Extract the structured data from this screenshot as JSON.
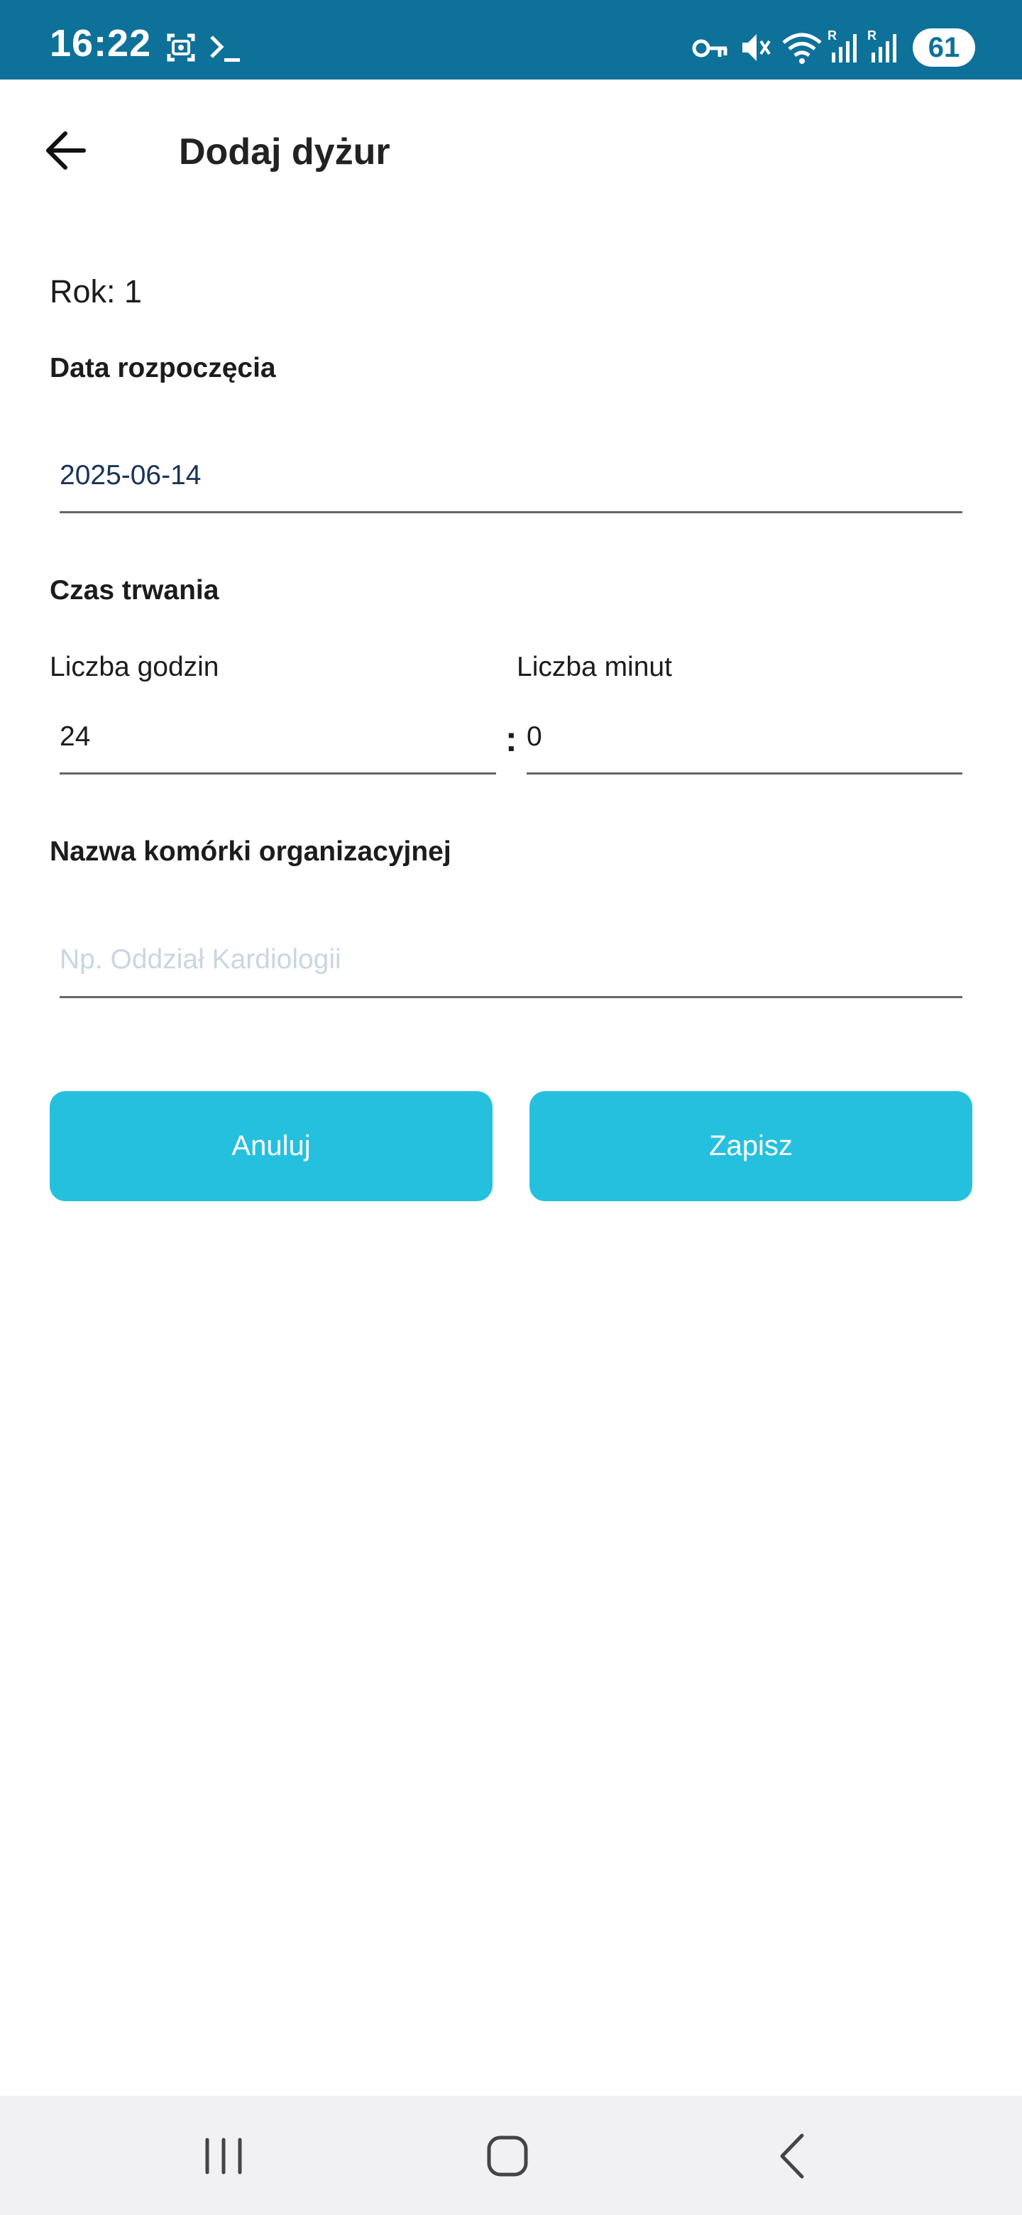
{
  "status_bar": {
    "time": "16:22",
    "battery": "61",
    "icons": [
      "screenshot-icon",
      "terminal-icon",
      "vpn-key-icon",
      "mute-icon",
      "wifi-icon",
      "signal-icon",
      "signal-icon"
    ]
  },
  "app_bar": {
    "title": "Dodaj dyżur",
    "back_icon": "arrow-left-icon"
  },
  "form": {
    "year": "Rok: 1",
    "start_date_label": "Data rozpoczęcia",
    "start_date_value": "2025-06-14",
    "duration_label": "Czas trwania",
    "hours_label": "Liczba godzin",
    "hours_value": "24",
    "separator": ":",
    "minutes_label": "Liczba minut",
    "minutes_value": "0",
    "unit_label": "Nazwa komórki organizacyjnej",
    "unit_placeholder": "Np. Oddział Kardiologii"
  },
  "buttons": {
    "cancel": "Anuluj",
    "save": "Zapisz"
  },
  "colors": {
    "status_bar": "#0e7199",
    "accent": "#26c0df",
    "nav_bar": "#f1f1f3"
  },
  "nav_bar": {
    "items": [
      "recent-apps-icon",
      "home-icon",
      "back-icon"
    ]
  }
}
